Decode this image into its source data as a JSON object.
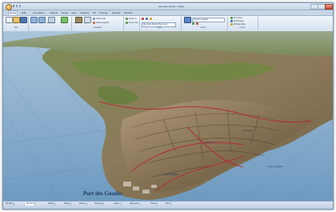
{
  "window": {
    "title": "Mountain Studio - [Map]"
  },
  "ribbon_tabs": [
    "Home",
    "Edit",
    "Annotation",
    "Objects",
    "Route",
    "View",
    "Tracking",
    "3D",
    "Printing",
    "Routing",
    "Window"
  ],
  "ribbon": {
    "home_group": {
      "label": "Map",
      "buttons": [
        "New",
        "Open",
        "Save"
      ]
    },
    "undo_group": {
      "buttons": [
        "Undo",
        "Redo",
        "Select Objects",
        "Import"
      ]
    },
    "display_group": {
      "label": "Navigation",
      "buttons": [
        "Shaded Relief",
        "Scale"
      ],
      "rows": [
        "Show Grid",
        "Show Legend"
      ]
    },
    "zoom_group": {
      "buttons": [
        "Zoom In",
        "Zoom Out"
      ]
    },
    "layers_group": {
      "label": "Tools",
      "combo_value": "Mountain Studio Map Layer"
    },
    "settings_group": {
      "label": "Search",
      "combo_value": "Search Location"
    },
    "right_group": {
      "label": "Layout",
      "rows": [
        "Overview",
        "Full Screen",
        "Window Size"
      ]
    }
  },
  "map": {
    "places": [
      "Port des Goudes",
      "Les Goudes",
      "Cap Croisette",
      "Calanques",
      "Morgiou"
    ]
  },
  "statusbar": {
    "tabs": [
      "2D Map",
      "3D View",
      "Profile",
      "Hiking",
      "Routes",
      "Overview",
      "Layers",
      "Waypoints",
      "Tracks",
      "Print"
    ]
  },
  "colors": {
    "sea": "#7fa8c9",
    "relief": "#8a7a5e",
    "vegetation": "#5f7a3a",
    "trail_red": "#b8262a",
    "ribbon": "#d5e1ef"
  }
}
